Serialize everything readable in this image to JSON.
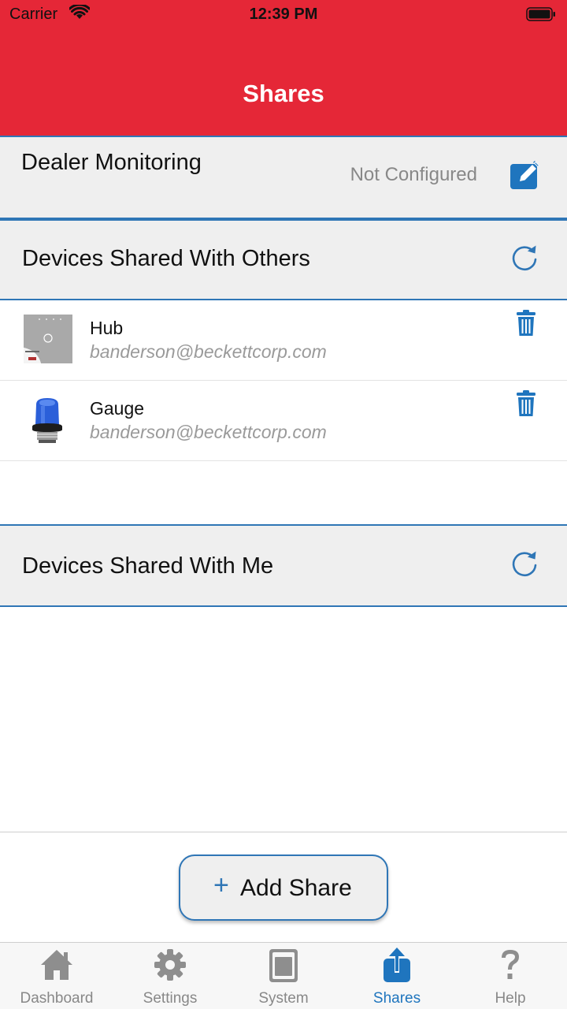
{
  "status_bar": {
    "carrier": "Carrier",
    "time": "12:39 PM"
  },
  "header": {
    "title": "Shares"
  },
  "dealer": {
    "label": "Dealer Monitoring",
    "status": "Not Configured",
    "edit_icon": "edit-icon"
  },
  "shared_with_others": {
    "title": "Devices Shared With Others",
    "refresh_icon": "refresh-icon",
    "items": [
      {
        "name": "Hub",
        "email": "banderson@beckettcorp.com",
        "icon": "hub-device-image"
      },
      {
        "name": "Gauge",
        "email": "banderson@beckettcorp.com",
        "icon": "gauge-device-image"
      }
    ]
  },
  "shared_with_me": {
    "title": "Devices Shared With Me",
    "refresh_icon": "refresh-icon"
  },
  "add_share": {
    "plus": "+",
    "label": "Add Share"
  },
  "tabs": [
    {
      "label": "Dashboard",
      "icon": "home-icon",
      "active": false
    },
    {
      "label": "Settings",
      "icon": "gear-icon",
      "active": false
    },
    {
      "label": "System",
      "icon": "system-icon",
      "active": false
    },
    {
      "label": "Shares",
      "icon": "share-icon",
      "active": true
    },
    {
      "label": "Help",
      "icon": "help-icon",
      "active": false
    }
  ],
  "colors": {
    "brand_red": "#e52737",
    "accent_blue": "#2f76b6",
    "tab_active": "#1f75be",
    "tab_inactive": "#888888"
  }
}
